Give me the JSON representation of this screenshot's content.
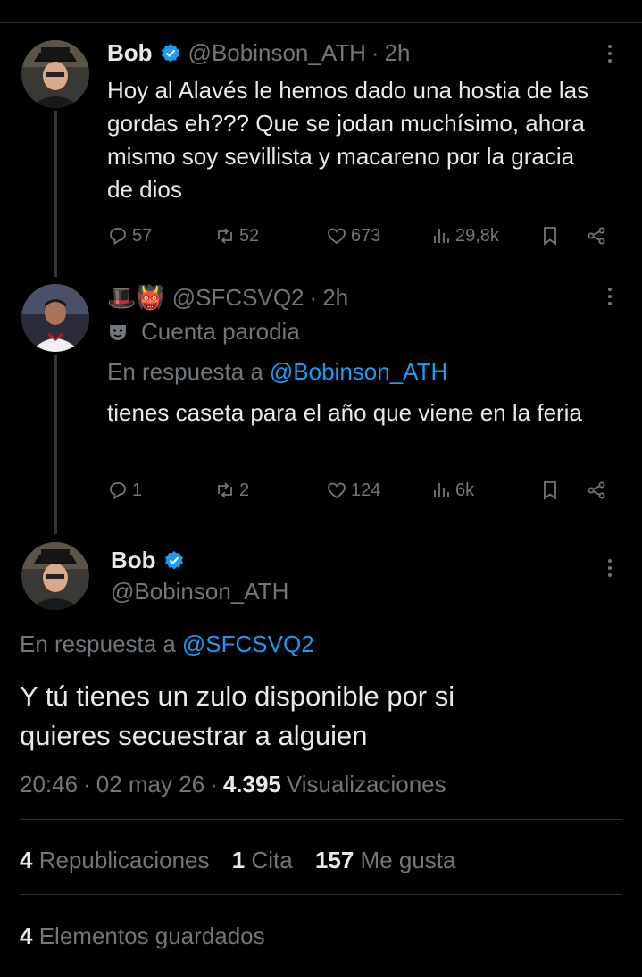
{
  "posts": [
    {
      "name": "Bob",
      "handle": "@Bobinson_ATH",
      "time": "2h",
      "text": "Hoy al Alavés le hemos dado una hostia de las gordas eh??? Que se jodan muchísimo, ahora mismo soy sevillista y macareno por la gracia de dios",
      "replies": "57",
      "reposts": "52",
      "likes": "673",
      "views": "29,8k"
    },
    {
      "name": "🎩👹",
      "handle": "@SFCSVQ2",
      "time": "2h",
      "label": "Cuenta parodia",
      "reply_prefix": "En respuesta a",
      "reply_to": "@Bobinson_ATH",
      "text": "tienes caseta para el año que viene en la feria",
      "replies": "1",
      "reposts": "2",
      "likes": "124",
      "views": "6k"
    }
  ],
  "main": {
    "name": "Bob",
    "handle": "@Bobinson_ATH",
    "reply_prefix": "En respuesta a",
    "reply_to": "@SFCSVQ2",
    "text": "Y tú tienes un zulo disponible por si quieres secuestrar a alguien",
    "time": "20:46",
    "date": "02 may 26",
    "views_count": "4.395",
    "views_label": "Visualizaciones",
    "reposts_count": "4",
    "reposts_label": "Republicaciones",
    "quotes_count": "1",
    "quotes_label": "Cita",
    "likes_count": "157",
    "likes_label": "Me gusta",
    "bookmarks_count": "4",
    "bookmarks_label": "Elementos guardados"
  },
  "icons": [
    "verified-icon",
    "more-icon",
    "reply-icon",
    "repost-icon",
    "like-icon",
    "views-icon",
    "bookmark-icon",
    "share-icon",
    "parody-mask-icon"
  ],
  "colors": {
    "background": "#000000",
    "text": "#e7e9ea",
    "secondary": "#71767b",
    "accent": "#1d9bf0"
  }
}
